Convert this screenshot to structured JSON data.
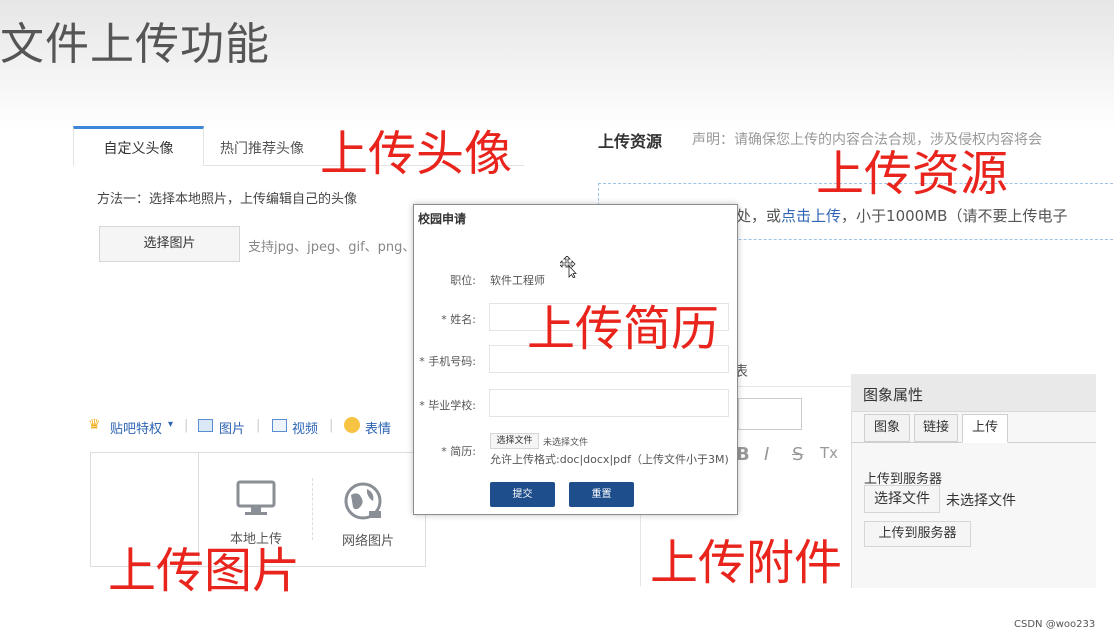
{
  "slide": {
    "title": "文件上传功能"
  },
  "labels": {
    "avatar": "上传头像",
    "resource": "上传资源",
    "resume": "上传简历",
    "image": "上传图片",
    "attachment": "上传附件"
  },
  "avatar_panel": {
    "tab_custom": "自定义头像",
    "tab_recommended": "热门推荐头像",
    "method_text": "方法一：选择本地照片，上传编辑自己的头像",
    "select_button": "选择图片",
    "support_text": "支持jpg、jpeg、gif、png、"
  },
  "resource_panel": {
    "title": "上传资源",
    "notice": "声明：请确保您上传的内容合法合规，涉及侵权内容将会",
    "drop_prefix": "处，或",
    "drop_link": "点击上传",
    "drop_suffix": "，小于1000MB（请不要上传电子"
  },
  "tieba_panel": {
    "privilege": "贴吧特权",
    "image": "图片",
    "video": "视频",
    "emoji": "表情",
    "local_upload": "本地上传",
    "network_image": "网络图片"
  },
  "school_modal": {
    "title": "校园申请",
    "position_label": "职位:",
    "position_value": "软件工程师",
    "name_label": "* 姓名:",
    "phone_label": "* 手机号码:",
    "school_label": "* 毕业学校:",
    "resume_label": "* 简历:",
    "choose_file": "选择文件",
    "no_file": "未选择文件",
    "format_hint": "允许上传格式:doc|docx|pdf（上传文件小于3M)",
    "submit": "提交",
    "reset": "重置"
  },
  "editor_panel": {
    "table_fragment": "表",
    "format_icons": [
      "B",
      "I",
      "S",
      "Tx"
    ]
  },
  "image_props": {
    "title": "图象属性",
    "tabs": [
      "图象",
      "链接",
      "上传"
    ],
    "upload_label": "上传到服务器",
    "choose_file": "选择文件",
    "no_file": "未选择文件",
    "upload_button": "上传到服务器"
  },
  "watermark": "CSDN @woo233",
  "colors": {
    "accent_red": "#e8241c",
    "modal_button": "#1f4e8c",
    "link_blue": "#2d64b3",
    "tab_accent": "#3e86d6"
  }
}
